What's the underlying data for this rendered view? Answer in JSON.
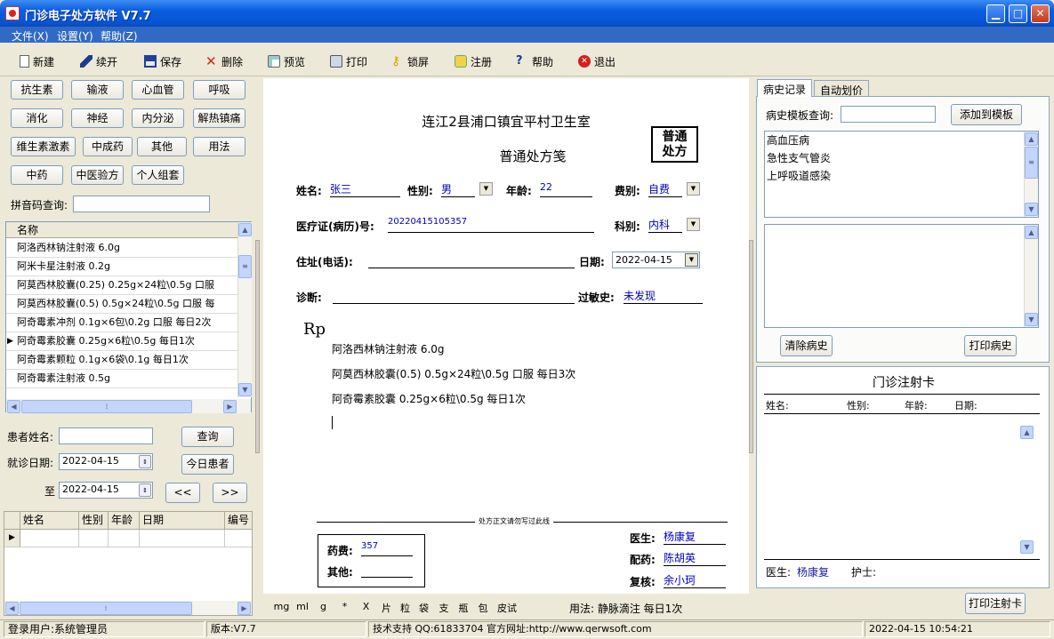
{
  "window": {
    "title": "门诊电子处方软件 V7.7",
    "min": "▁",
    "max": "□",
    "close": "✕"
  },
  "menu": {
    "file": "文件(X)",
    "settings": "设置(Y)",
    "help": "帮助(Z)"
  },
  "toolbar": {
    "new": "新建",
    "continue": "续开",
    "save": "保存",
    "delete": "删除",
    "preview": "预览",
    "print": "打印",
    "lock": "锁屏",
    "register": "注册",
    "help": "帮助",
    "exit": "退出"
  },
  "categories": [
    "抗生素",
    "输液",
    "心血管",
    "呼吸",
    "消化",
    "神经",
    "内分泌",
    "解热镇痛",
    "维生素激素",
    "中成药",
    "其他",
    "用法",
    "中药",
    "中医验方",
    "个人组套"
  ],
  "pinyin_label": "拼音码查询:",
  "drug_list": {
    "header": "名称",
    "items": [
      "阿洛西林钠注射液 6.0g",
      "阿米卡星注射液  0.2g",
      "阿莫西林胶囊(0.25)  0.25g×24粒\\0.5g 口服",
      "阿莫西林胶囊(0.5)  0.5g×24粒\\0.5g 口服 每",
      "阿奇霉素冲剂  0.1g×6包\\0.2g 口服 每日2次",
      "阿奇霉素胶囊  0.25g×6粒\\0.5g  每日1次",
      "阿奇霉素颗粒  0.1g×6袋\\0.1g  每日1次",
      "阿奇霉素注射液  0.5g"
    ]
  },
  "search": {
    "patient_label": "患者姓名:",
    "query": "查询",
    "date_label": "就诊日期:",
    "date_from": "2022-04-15",
    "to_label": "至",
    "date_to": "2022-04-15",
    "today": "今日患者",
    "prev": "<<",
    "next": ">>"
  },
  "patient_table": {
    "headers": [
      "姓名",
      "性别",
      "年龄",
      "日期",
      "编号"
    ]
  },
  "rx": {
    "clinic": "连江2县浦口镇宜平村卫生室",
    "title": "普通处方笺",
    "stamp_line1": "普通",
    "stamp_line2": "处方",
    "name_label": "姓名:",
    "name": "张三",
    "sex_label": "性别:",
    "sex": "男",
    "age_label": "年龄:",
    "age": "22",
    "fee_label": "费别:",
    "fee": "自费",
    "record_label": "医疗证(病历)号:",
    "record": "20220415105357",
    "dept_label": "科别:",
    "dept": "内科",
    "address_label": "住址(电话):",
    "date_label": "日期:",
    "date": "2022-04-15",
    "diag_label": "诊断:",
    "allergy_label": "过敏史:",
    "allergy": "未发现",
    "rp": "Rp",
    "drugs": [
      "阿洛西林钠注射液 6.0g",
      "阿莫西林胶囊(0.5)  0.5g×24粒\\0.5g 口服  每日3次",
      "阿奇霉素胶囊  0.25g×6粒\\0.5g  每日1次"
    ],
    "divider": "处方正文请勿写过此线",
    "drug_fee_label": "药费:",
    "drug_fee": "357",
    "other_label": "其他:",
    "doctor_label": "医生:",
    "doctor": "杨康复",
    "dispense_label": "配药:",
    "dispenser": "陈胡英",
    "review_label": "复核:",
    "reviewer": "余小珂"
  },
  "units": [
    "mg",
    "ml",
    "g",
    "*",
    "X",
    "片",
    "粒",
    "袋",
    "支",
    "瓶",
    "包",
    "皮试"
  ],
  "usage_text": "用法: 静脉滴注 每日1次",
  "right": {
    "tab_history": "病史记录",
    "tab_pricing": "自动划价",
    "template_label": "病史模板查询:",
    "add_template": "添加到模板",
    "history_items": [
      "高血压病",
      "急性支气管炎",
      "上呼吸道感染"
    ],
    "clear_history": "清除病史",
    "print_history": "打印病史",
    "card_title": "门诊注射卡",
    "card_name": "姓名:",
    "card_sex": "性别:",
    "card_age": "年龄:",
    "card_date": "日期:",
    "card_doctor_label": "医生:",
    "card_doctor": "杨康复",
    "card_nurse": "护士:",
    "print_card": "打印注射卡"
  },
  "status": {
    "user": "登录用户:系统管理员",
    "version": "版本:V7.7",
    "support": "技术支持 QQ:61833704 官方网址:http://www.qerwsoft.com",
    "datetime": "2022-04-15 10:54:21"
  }
}
